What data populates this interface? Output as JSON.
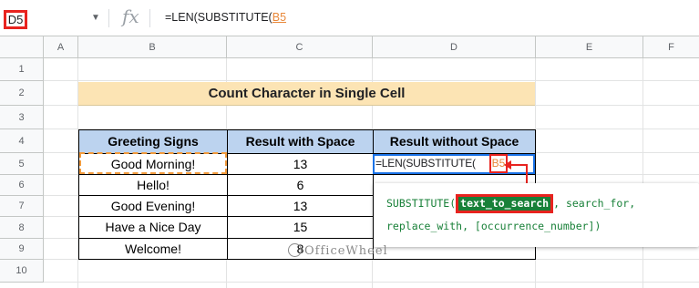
{
  "formula_bar": {
    "name_box": "D5",
    "fx_label": "fx",
    "formula_prefix": "=LEN(SUBSTITUTE(",
    "formula_ref": "B5"
  },
  "columns": [
    "A",
    "B",
    "C",
    "D",
    "E",
    "F"
  ],
  "rows": [
    "1",
    "2",
    "3",
    "4",
    "5",
    "6",
    "7",
    "8",
    "9",
    "10"
  ],
  "title": "Count Character in Single Cell",
  "table": {
    "headers": [
      "Greeting Signs",
      "Result with Space",
      "Result without Space"
    ],
    "rows": [
      [
        "Good Morning!",
        "13"
      ],
      [
        "Hello!",
        "6"
      ],
      [
        "Good Evening!",
        "13"
      ],
      [
        "Have a Nice Day",
        "15"
      ],
      [
        "Welcome!",
        "8"
      ]
    ]
  },
  "active_cell": {
    "edit_prefix": "=LEN(SUBSTITUTE(",
    "edit_ref": "B5"
  },
  "tooltip": {
    "function_name": "SUBSTITUTE(",
    "current_param": "text_to_search",
    "line1_rest": ", search_for,",
    "line2": "replace_with, [occurrence_number])"
  },
  "watermark": "OfficeWheel",
  "colors": {
    "header_fill": "#bcd3ef",
    "title_fill": "#fce4b4",
    "highlight_red": "#e8231f",
    "ref_orange": "#e8883a",
    "tooltip_green": "#188038",
    "active_blue": "#1a73e8"
  }
}
